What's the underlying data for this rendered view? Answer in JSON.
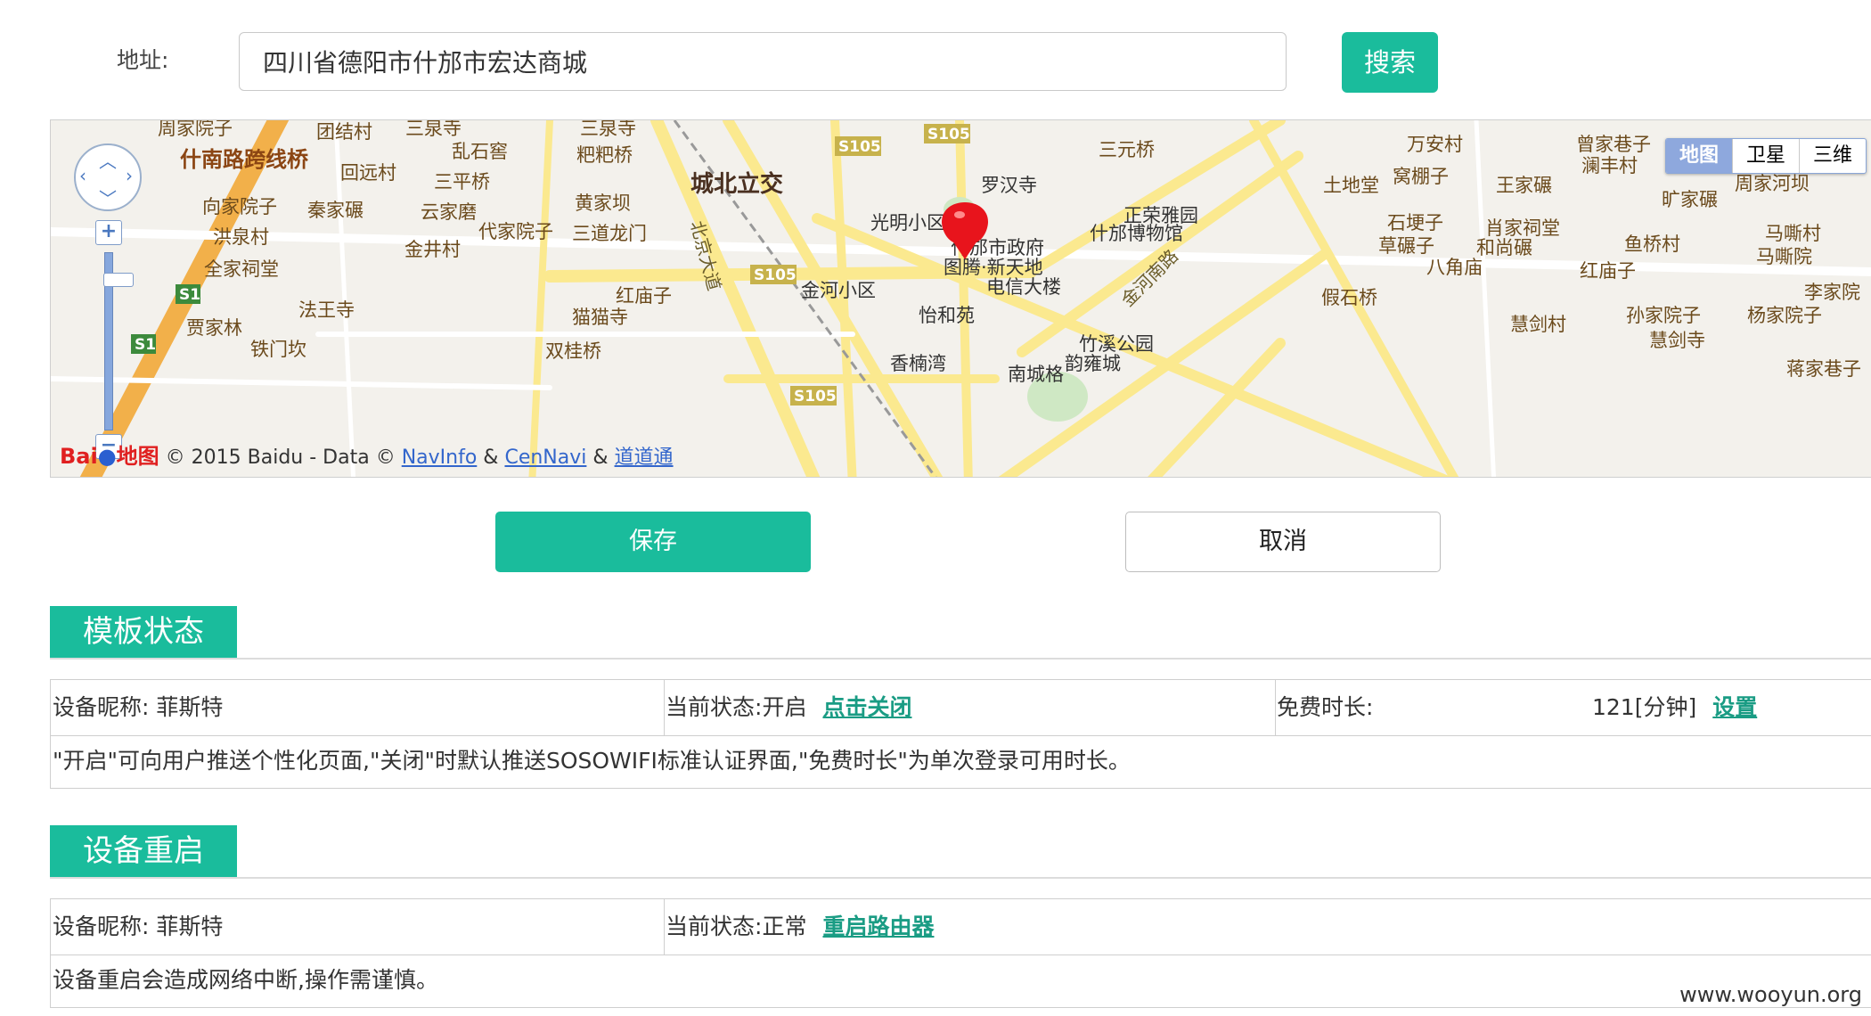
{
  "address": {
    "label": "地址:",
    "value": "四川省德阳市什邡市宏达商城",
    "search_label": "搜索"
  },
  "map": {
    "types": [
      "地图",
      "卫星",
      "三维"
    ],
    "active_type": "地图",
    "copyright": "© 2015 Baidu - Data ©",
    "providers": [
      "NavInfo",
      "CenNavi",
      "道道通"
    ],
    "logo_text": "Bai",
    "logo_suffix": "地图",
    "labels": {
      "road_s105": "S105",
      "road_s1": "S1",
      "chengbei": "城北立交",
      "shinan": "什南路跨线桥",
      "luohansi": "罗汉寺",
      "guangming": "光明小区",
      "zhengrong": "正荣雅园",
      "gov": "什邡市政府",
      "museum": "什邡博物馆",
      "tuteng": "图腾·新天地",
      "dianxin": "电信大楼",
      "jinhe": "金河小区",
      "yihe": "怡和苑",
      "zhuxi": "竹溪公园",
      "yongcheng": "韵雍城",
      "xiangnan": "香楠湾",
      "nancheng": "南城格",
      "jinhe_road": "金河南路",
      "beijing_ave": "北京大道",
      "tudi": "土地堂",
      "wanan": "万安村",
      "shiba": "石埂子",
      "jiashi": "假石桥",
      "huijian": "慧剑村",
      "yuqiao": "鱼桥村",
      "sanyuan": "三元桥",
      "sanquan": "三泉寺",
      "luanshi": "乱石窖",
      "sanping": "三平桥",
      "yunjia": "云家磨",
      "daijia": "代家院子",
      "jinjing": "金井村",
      "hongmiao": "红庙子",
      "maomao": "猫猫寺",
      "shuanggui": "双桂桥",
      "fawang": "法王寺",
      "jiajia": "贾家林",
      "tiemen": "铁门坎",
      "hongquan": "洪泉村",
      "quanjia": "全家祠堂",
      "qinjia": "秦家碾",
      "xiangjia": "向家院子",
      "huiyuan": "回远村",
      "tuanjie": "团结村",
      "zhoujia": "周家院子",
      "huangjia": "黄家坝",
      "sandao": "三道龙门",
      "bapa": "粑粑桥",
      "zengjia": "曾家巷子",
      "lanfeng": "澜丰村",
      "wangjia": "王家碾",
      "wopeng": "窝棚子",
      "kuangjia": "旷家碾",
      "zhoujiahe": "周家河坝",
      "xiaojia": "肖家祠堂",
      "heshang": "和尚碾",
      "cao": "草碾子",
      "bajiao": "八角庙",
      "hongmiao2": "红庙子",
      "masi": "马嘶村",
      "masiyuan": "马嘶院",
      "lijia": "李家院",
      "sunjia": "孙家院子",
      "yangjia": "杨家院子",
      "huijiansi": "慧剑寺",
      "jiangjia": "蒋家巷子"
    }
  },
  "actions": {
    "save_label": "保存",
    "cancel_label": "取消"
  },
  "template_status": {
    "title": "模板状态",
    "nickname_label": "设备昵称:",
    "nickname": "菲斯特",
    "status_label": "当前状态:",
    "status_value": "开启",
    "toggle_link": "点击关闭",
    "free_label": "免费时长:",
    "free_value": "121[分钟]",
    "free_link": "设置",
    "note": "\"开启\"可向用户推送个性化页面,\"关闭\"时默认推送SOSOWIFI标准认证界面,\"免费时长\"为单次登录可用时长。"
  },
  "reboot": {
    "title": "设备重启",
    "nickname_label": "设备昵称:",
    "nickname": "菲斯特",
    "status_label": "当前状态:",
    "status_value": "正常",
    "reboot_link": "重启路由器",
    "note": "设备重启会造成网络中断,操作需谨慎。"
  },
  "watermark": "www.wooyun.org",
  "colors": {
    "accent": "#1abc9c",
    "link": "#1a9c84",
    "map_road": "#fbe98f",
    "map_bg": "#f3f1ec",
    "marker": "#e8141c"
  }
}
